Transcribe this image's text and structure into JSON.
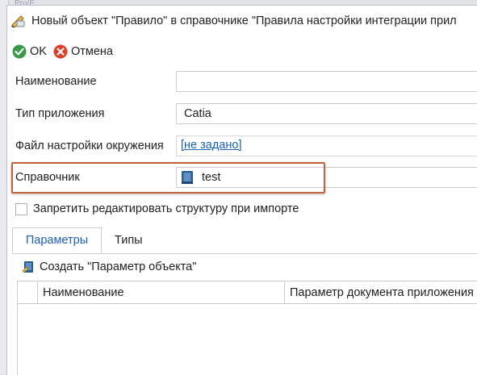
{
  "background": {
    "partial_text": "Pro/E"
  },
  "window": {
    "title": "Новый объект \"Правило\" в справочнике \"Правила настройки интеграции прил"
  },
  "toolbar": {
    "ok_label": "OK",
    "cancel_label": "Отмена"
  },
  "form": {
    "name_label": "Наименование",
    "name_value": "",
    "app_type_label": "Тип приложения",
    "app_type_value": "Catia",
    "env_file_label": "Файл настройки окружения",
    "env_file_value": "[не задано]",
    "reference_label": "Справочник",
    "reference_value": "test",
    "lock_structure_label": "Запретить редактировать структуру при импорте",
    "lock_structure_checked": false
  },
  "tabs": [
    {
      "label": "Параметры",
      "active": true
    },
    {
      "label": "Типы",
      "active": false
    }
  ],
  "params": {
    "create_label": "Создать \"Параметр объекта\"",
    "columns": [
      "Наименование",
      "Параметр документа приложения"
    ]
  },
  "colors": {
    "accent": "#1a5fb4",
    "highlight_border": "#c0603c",
    "ok_green": "#3a9a48",
    "cancel_red": "#d9412e"
  }
}
